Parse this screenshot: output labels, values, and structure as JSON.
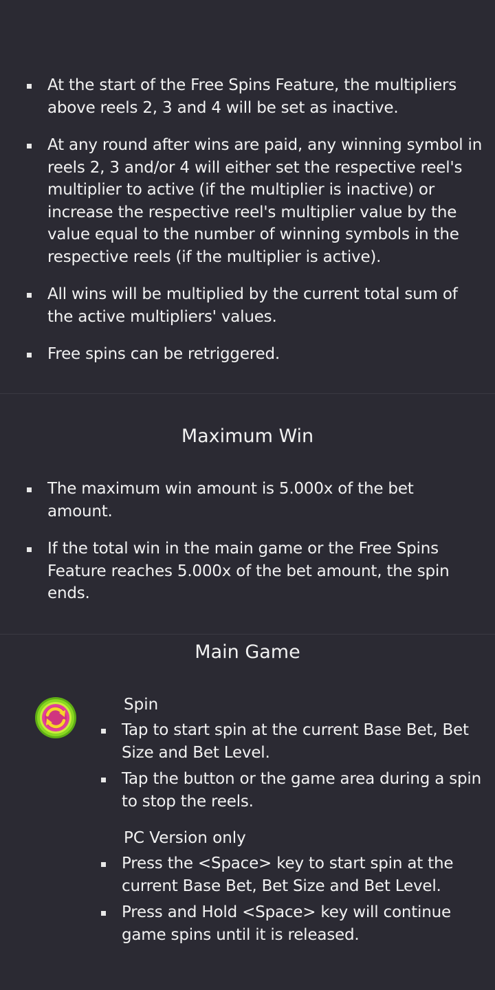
{
  "free_spins": {
    "bullets": [
      "At the start of the Free Spins Feature, the multipliers above reels 2, 3 and 4 will be set as inactive.",
      "At any round after wins are paid, any winning symbol in reels 2, 3 and/or 4 will either set the respective reel's multiplier to active (if the multiplier is inactive) or increase the respective reel's multiplier value by the value equal to the number of winning symbols in the respective reels (if the multiplier is active).",
      "All wins will be multiplied by the current total sum of the active multipliers' values.",
      "Free spins can be retriggered."
    ]
  },
  "maximum_win": {
    "title": "Maximum Win",
    "bullets": [
      "The maximum win amount is 5.000x of the bet amount.",
      "If the total win in the main game or the Free Spins Feature reaches 5.000x of the bet amount, the spin ends."
    ]
  },
  "main_game": {
    "title": "Main Game",
    "spin": {
      "icon": "spin-button-icon",
      "icon_colors": {
        "ring": "#7fd11f",
        "inner": "#e23f8e",
        "arrows": "#f7d52a"
      },
      "title": "Spin",
      "bullets": [
        "Tap to start spin at the current Base Bet, Bet Size and Bet Level.",
        "Tap the button or the game area during a spin to stop the reels."
      ],
      "pc_title": "PC Version only",
      "pc_bullets": [
        "Press the <Space> key to start spin at the current Base Bet, Bet Size and Bet Level.",
        "Press and Hold <Space> key will continue game spins until it is released."
      ]
    }
  },
  "colors": {
    "background": "#2b2a33",
    "text": "#f2f2f2",
    "divider": "#3a3942"
  }
}
